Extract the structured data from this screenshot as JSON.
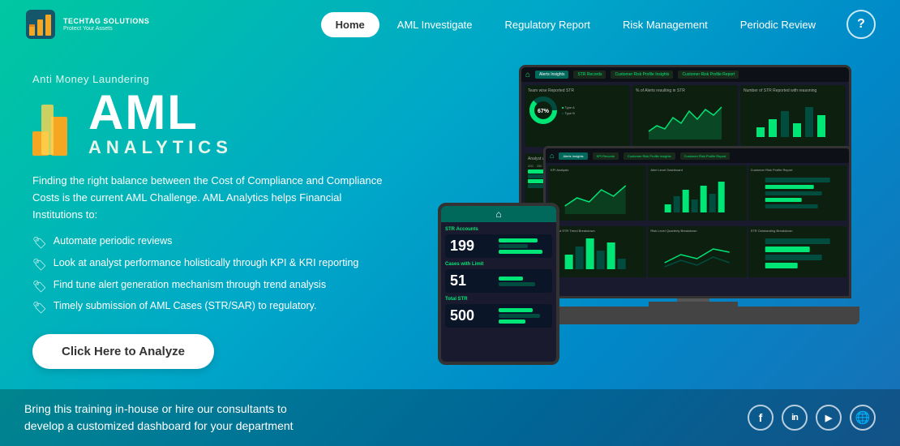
{
  "brand": {
    "name": "TECHTAG SOLUTIONS",
    "tagline": "Protect Your Assets",
    "logo_alt": "TechTag Logo"
  },
  "navbar": {
    "home_label": "Home",
    "aml_investigate_label": "AML Investigate",
    "regulatory_report_label": "Regulatory Report",
    "risk_management_label": "Risk Management",
    "periodic_review_label": "Periodic Review",
    "help_label": "?"
  },
  "hero": {
    "subtitle": "Anti Money Laundering",
    "title_main": "AML",
    "title_sub": "ANALYTICS",
    "description": "Finding the right balance between the Cost of Compliance and Compliance Costs is the current AML Challenge. AML Analytics helps Financial Institutions to:",
    "features": [
      "Automate periodic reviews",
      "Look at analyst performance holistically through KPI & KRI reporting",
      "Find tune alert generation mechanism through trend analysis",
      "Timely submission of AML Cases (STR/SAR) to regulatory."
    ],
    "cta_label": "Click Here to Analyze"
  },
  "footer": {
    "text_line1": "Bring this training in-house or hire our consultants to",
    "text_line2": "develop a customized dashboard for your department",
    "social": {
      "facebook": "f",
      "linkedin": "in",
      "youtube": "▶",
      "globe": "🌐"
    }
  },
  "dashboard_tabs": {
    "tab1": "Alerts Insights",
    "tab2": "STR Records",
    "tab3": "Customer Risk Profile Insights",
    "tab4": "Customer Risk Profile Report"
  },
  "stats": {
    "val1": "199",
    "val2": "51",
    "val3": "500"
  }
}
